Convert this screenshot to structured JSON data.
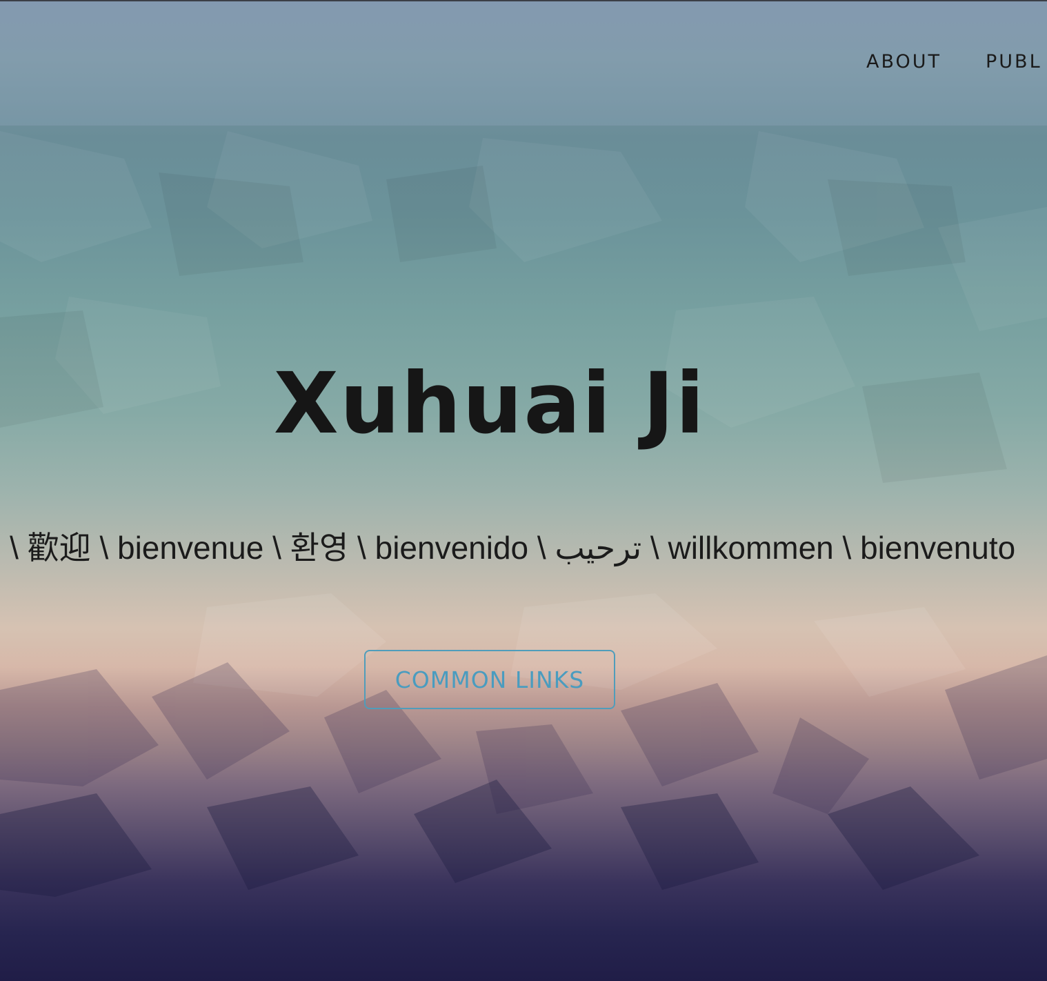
{
  "nav": {
    "items": [
      {
        "label": "ABOUT"
      },
      {
        "label": "PUBL"
      }
    ]
  },
  "hero": {
    "title": "Xuhuai Ji",
    "welcome_text": "- \\ 歡迎 \\ bienvenue \\ 환영 \\ bienvenido \\ ترحيب \\ willkommen \\ bienvenuto",
    "cta_label": "COMMON LINKS"
  },
  "colors": {
    "cta_accent": "#4a9cbf",
    "title_text": "#161616"
  }
}
